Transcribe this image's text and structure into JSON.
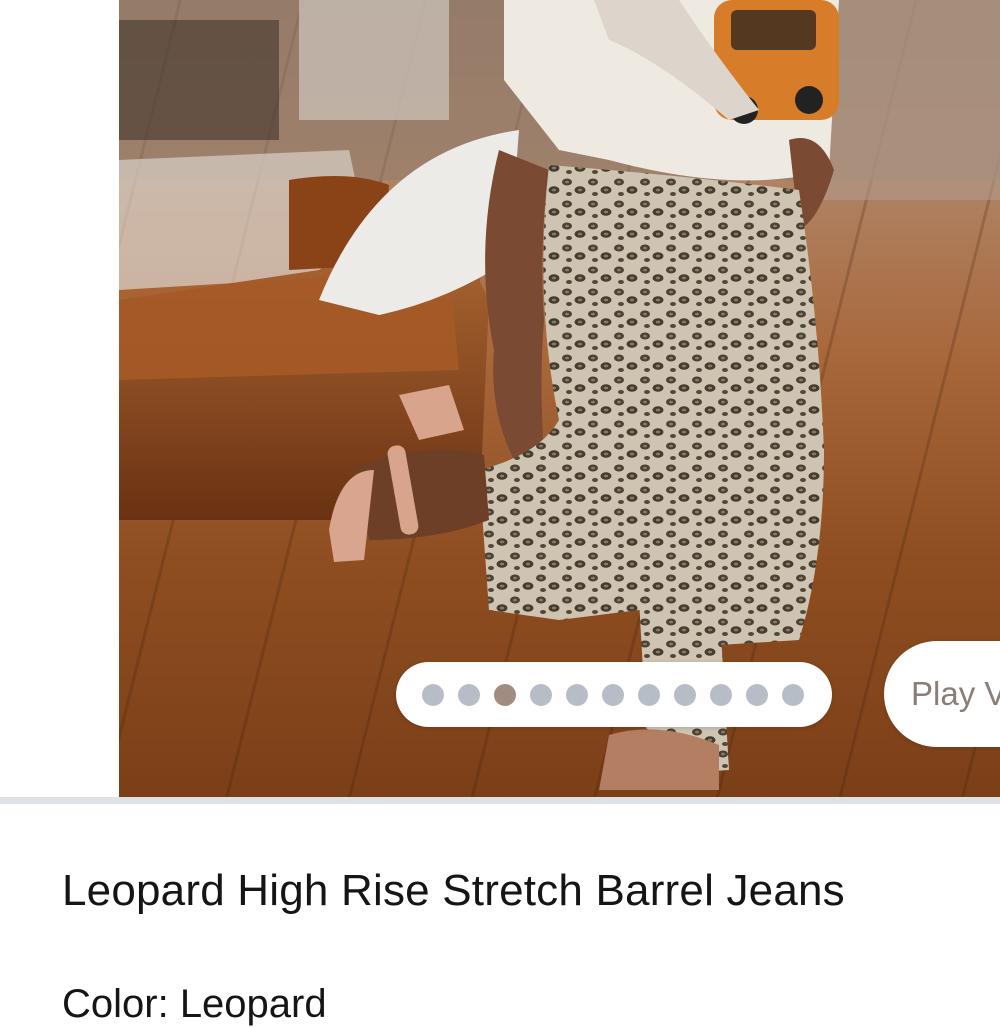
{
  "gallery": {
    "image_alt": "Leopard High Rise Stretch Barrel Jeans product photo",
    "slide_count": 11,
    "active_slide": 3,
    "play_label": "Play V"
  },
  "product": {
    "title": "Leopard High Rise Stretch Barrel Jeans",
    "color_line": "Color: Leopard"
  },
  "colors": {
    "dot_inactive": "#b7bdc6",
    "dot_active": "#a08c80",
    "divider": "#dee1e6",
    "text": "#151515"
  }
}
